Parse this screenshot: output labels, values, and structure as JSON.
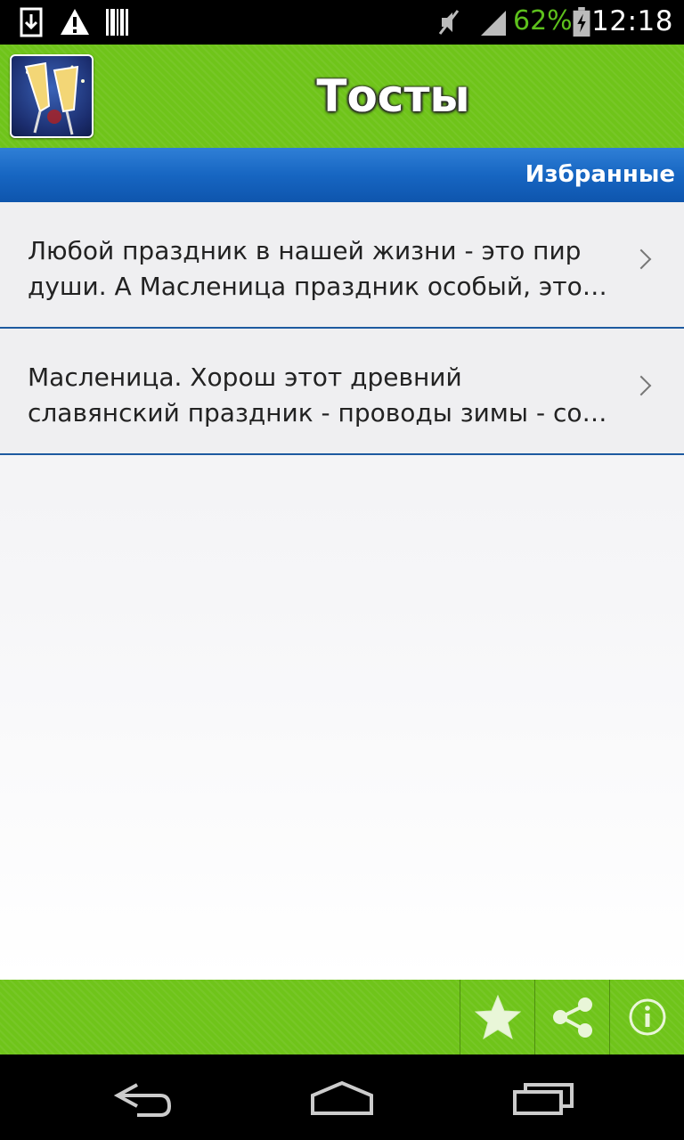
{
  "status_bar": {
    "battery_percent": "62%",
    "time": "12:18",
    "icons": [
      "download-icon",
      "warning-icon",
      "barcode-icon",
      "mute-icon",
      "signal-icon",
      "battery-charging-icon"
    ]
  },
  "header": {
    "title": "Тосты",
    "app_icon": "champagne-glasses-icon"
  },
  "subheader": {
    "label": "Избранные"
  },
  "list": {
    "items": [
      {
        "line1": "Любой праздник в нашей жизни - это пир",
        "line2": "души. А Масленица праздник особый, это…"
      },
      {
        "line1": "Масленица. Хорош этот древний",
        "line2": "славянский праздник - проводы зимы - со…"
      }
    ]
  },
  "toolbar": {
    "buttons": [
      "star-icon",
      "share-icon",
      "info-icon"
    ]
  },
  "nav": {
    "buttons": [
      "back-icon",
      "home-icon",
      "recents-icon"
    ]
  },
  "colors": {
    "header_green": "#6fc41a",
    "bar_blue": "#1766c2",
    "battery_green": "#5dc01c",
    "divider_blue": "#1d5aa0"
  }
}
